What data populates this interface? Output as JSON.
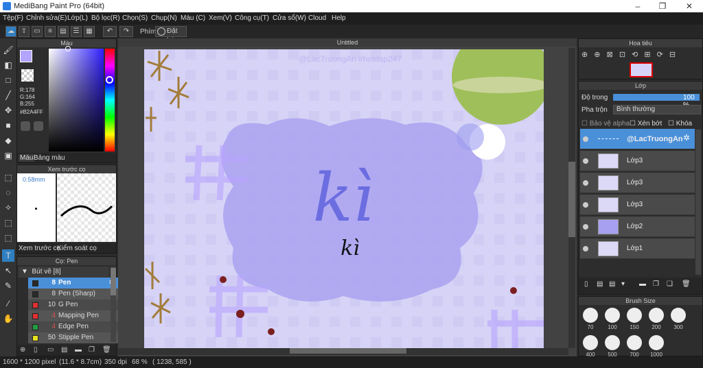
{
  "window": {
    "title": "MediBang Paint Pro (64bit)",
    "minimize": "–",
    "maximize": "❐",
    "close": "✕"
  },
  "menu": [
    "Tệp(F)",
    "Chỉnh sửa(E)",
    "Lớp(L)",
    "Bộ lọc(R)",
    "Chọn(S)",
    "Chụp(N)",
    "Màu (C)",
    "Xem(V)",
    "Công cụ(T)",
    "Cửa sổ(W)",
    "Cloud",
    "Help"
  ],
  "toolbar": {
    "undo": "↶",
    "redo": "↷",
    "phim": "Phím",
    "reset": "Đặt lại"
  },
  "color_panel": {
    "title": "Màu",
    "r": "R:178",
    "g": "G:164",
    "b": "B:255",
    "hex": "#B2A4FF",
    "tab1": "Màu",
    "tab2": "Bảng màu",
    "fg": "#B2A4FF"
  },
  "preview_panel": {
    "title": "Xem trước cọ",
    "size": "0.58mm",
    "tab1": "Xem trước cọ",
    "tab2": "Kiểm soát cọ"
  },
  "brush_panel": {
    "title": "Cọ: Pen",
    "group": "Bút vẽ [8]",
    "items": [
      {
        "size": "8",
        "name": "Pen",
        "color": "#2a2a2a"
      },
      {
        "size": "8",
        "name": "Pen (Sharp)",
        "color": "#2a2a2a"
      },
      {
        "size": "10",
        "name": "G Pen",
        "color": "#e03030"
      },
      {
        "size": "4",
        "name": "Mapping Pen",
        "color": "#e03030"
      },
      {
        "size": "4",
        "name": "Edge Pen",
        "color": "#20a040"
      },
      {
        "size": "50",
        "name": "Stipple Pen",
        "color": "#e8e020"
      }
    ]
  },
  "document": {
    "tab": "Untitled",
    "watermark": "@LacTruongAn  #hoidap247",
    "art_title": "kì",
    "art_sub": "kì"
  },
  "navigator": {
    "title": "Hoa tiêu"
  },
  "layers_panel": {
    "title": "Lớp",
    "opacity_label": "Độ trong",
    "opacity": "100 %",
    "blend_label": "Pha trộn",
    "blend": "Bình thường",
    "alpha": "Bảo vệ alpha",
    "clip": "Xén bớt",
    "lock": "Khóa",
    "layers": [
      "@LacTruongAn",
      "Lớp3",
      "Lớp3",
      "Lớp3",
      "Lớp2",
      "Lớp1"
    ]
  },
  "brush_size": {
    "title": "Brush Size",
    "sizes": [
      "70",
      "100",
      "150",
      "200",
      "300",
      "400",
      "500",
      "700",
      "1000"
    ]
  },
  "status": {
    "size": "1600 * 1200 pixel",
    "cm": "(11.6 * 8.7cm)",
    "dpi": "350 dpi",
    "zoom": "68 %",
    "coords": "( 1238, 585 )"
  }
}
